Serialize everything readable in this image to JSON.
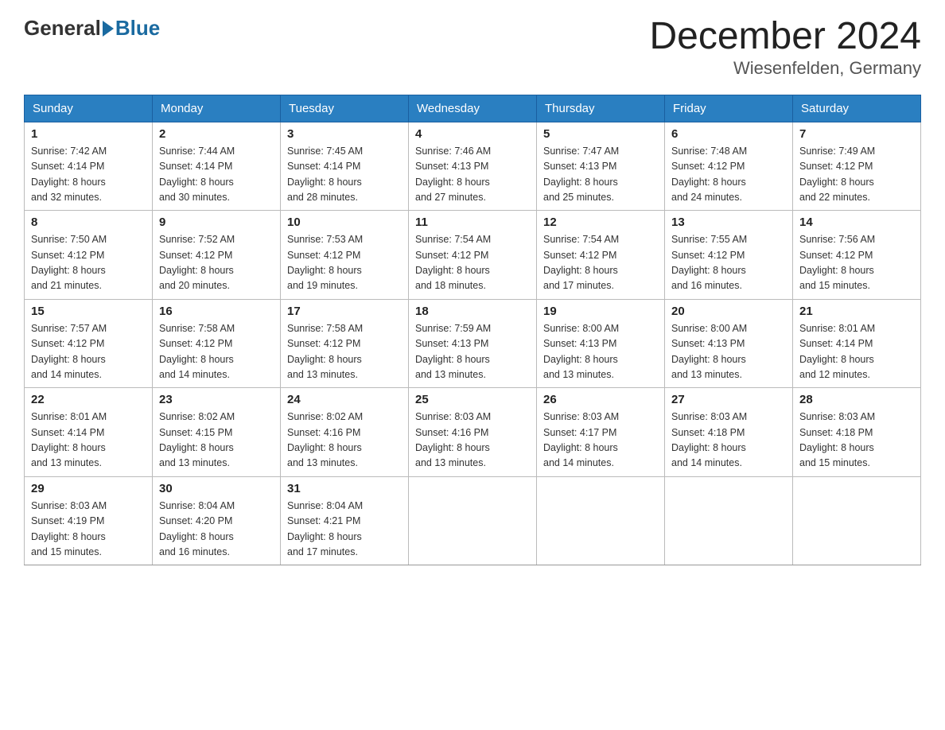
{
  "header": {
    "logo_general": "General",
    "logo_blue": "Blue",
    "month_title": "December 2024",
    "location": "Wiesenfelden, Germany"
  },
  "days_of_week": [
    "Sunday",
    "Monday",
    "Tuesday",
    "Wednesday",
    "Thursday",
    "Friday",
    "Saturday"
  ],
  "weeks": [
    [
      {
        "day": "1",
        "sunrise": "7:42 AM",
        "sunset": "4:14 PM",
        "daylight": "8 hours and 32 minutes."
      },
      {
        "day": "2",
        "sunrise": "7:44 AM",
        "sunset": "4:14 PM",
        "daylight": "8 hours and 30 minutes."
      },
      {
        "day": "3",
        "sunrise": "7:45 AM",
        "sunset": "4:14 PM",
        "daylight": "8 hours and 28 minutes."
      },
      {
        "day": "4",
        "sunrise": "7:46 AM",
        "sunset": "4:13 PM",
        "daylight": "8 hours and 27 minutes."
      },
      {
        "day": "5",
        "sunrise": "7:47 AM",
        "sunset": "4:13 PM",
        "daylight": "8 hours and 25 minutes."
      },
      {
        "day": "6",
        "sunrise": "7:48 AM",
        "sunset": "4:12 PM",
        "daylight": "8 hours and 24 minutes."
      },
      {
        "day": "7",
        "sunrise": "7:49 AM",
        "sunset": "4:12 PM",
        "daylight": "8 hours and 22 minutes."
      }
    ],
    [
      {
        "day": "8",
        "sunrise": "7:50 AM",
        "sunset": "4:12 PM",
        "daylight": "8 hours and 21 minutes."
      },
      {
        "day": "9",
        "sunrise": "7:52 AM",
        "sunset": "4:12 PM",
        "daylight": "8 hours and 20 minutes."
      },
      {
        "day": "10",
        "sunrise": "7:53 AM",
        "sunset": "4:12 PM",
        "daylight": "8 hours and 19 minutes."
      },
      {
        "day": "11",
        "sunrise": "7:54 AM",
        "sunset": "4:12 PM",
        "daylight": "8 hours and 18 minutes."
      },
      {
        "day": "12",
        "sunrise": "7:54 AM",
        "sunset": "4:12 PM",
        "daylight": "8 hours and 17 minutes."
      },
      {
        "day": "13",
        "sunrise": "7:55 AM",
        "sunset": "4:12 PM",
        "daylight": "8 hours and 16 minutes."
      },
      {
        "day": "14",
        "sunrise": "7:56 AM",
        "sunset": "4:12 PM",
        "daylight": "8 hours and 15 minutes."
      }
    ],
    [
      {
        "day": "15",
        "sunrise": "7:57 AM",
        "sunset": "4:12 PM",
        "daylight": "8 hours and 14 minutes."
      },
      {
        "day": "16",
        "sunrise": "7:58 AM",
        "sunset": "4:12 PM",
        "daylight": "8 hours and 14 minutes."
      },
      {
        "day": "17",
        "sunrise": "7:58 AM",
        "sunset": "4:12 PM",
        "daylight": "8 hours and 13 minutes."
      },
      {
        "day": "18",
        "sunrise": "7:59 AM",
        "sunset": "4:13 PM",
        "daylight": "8 hours and 13 minutes."
      },
      {
        "day": "19",
        "sunrise": "8:00 AM",
        "sunset": "4:13 PM",
        "daylight": "8 hours and 13 minutes."
      },
      {
        "day": "20",
        "sunrise": "8:00 AM",
        "sunset": "4:13 PM",
        "daylight": "8 hours and 13 minutes."
      },
      {
        "day": "21",
        "sunrise": "8:01 AM",
        "sunset": "4:14 PM",
        "daylight": "8 hours and 12 minutes."
      }
    ],
    [
      {
        "day": "22",
        "sunrise": "8:01 AM",
        "sunset": "4:14 PM",
        "daylight": "8 hours and 13 minutes."
      },
      {
        "day": "23",
        "sunrise": "8:02 AM",
        "sunset": "4:15 PM",
        "daylight": "8 hours and 13 minutes."
      },
      {
        "day": "24",
        "sunrise": "8:02 AM",
        "sunset": "4:16 PM",
        "daylight": "8 hours and 13 minutes."
      },
      {
        "day": "25",
        "sunrise": "8:03 AM",
        "sunset": "4:16 PM",
        "daylight": "8 hours and 13 minutes."
      },
      {
        "day": "26",
        "sunrise": "8:03 AM",
        "sunset": "4:17 PM",
        "daylight": "8 hours and 14 minutes."
      },
      {
        "day": "27",
        "sunrise": "8:03 AM",
        "sunset": "4:18 PM",
        "daylight": "8 hours and 14 minutes."
      },
      {
        "day": "28",
        "sunrise": "8:03 AM",
        "sunset": "4:18 PM",
        "daylight": "8 hours and 15 minutes."
      }
    ],
    [
      {
        "day": "29",
        "sunrise": "8:03 AM",
        "sunset": "4:19 PM",
        "daylight": "8 hours and 15 minutes."
      },
      {
        "day": "30",
        "sunrise": "8:04 AM",
        "sunset": "4:20 PM",
        "daylight": "8 hours and 16 minutes."
      },
      {
        "day": "31",
        "sunrise": "8:04 AM",
        "sunset": "4:21 PM",
        "daylight": "8 hours and 17 minutes."
      },
      null,
      null,
      null,
      null
    ]
  ],
  "labels": {
    "sunrise": "Sunrise:",
    "sunset": "Sunset:",
    "daylight": "Daylight:"
  }
}
